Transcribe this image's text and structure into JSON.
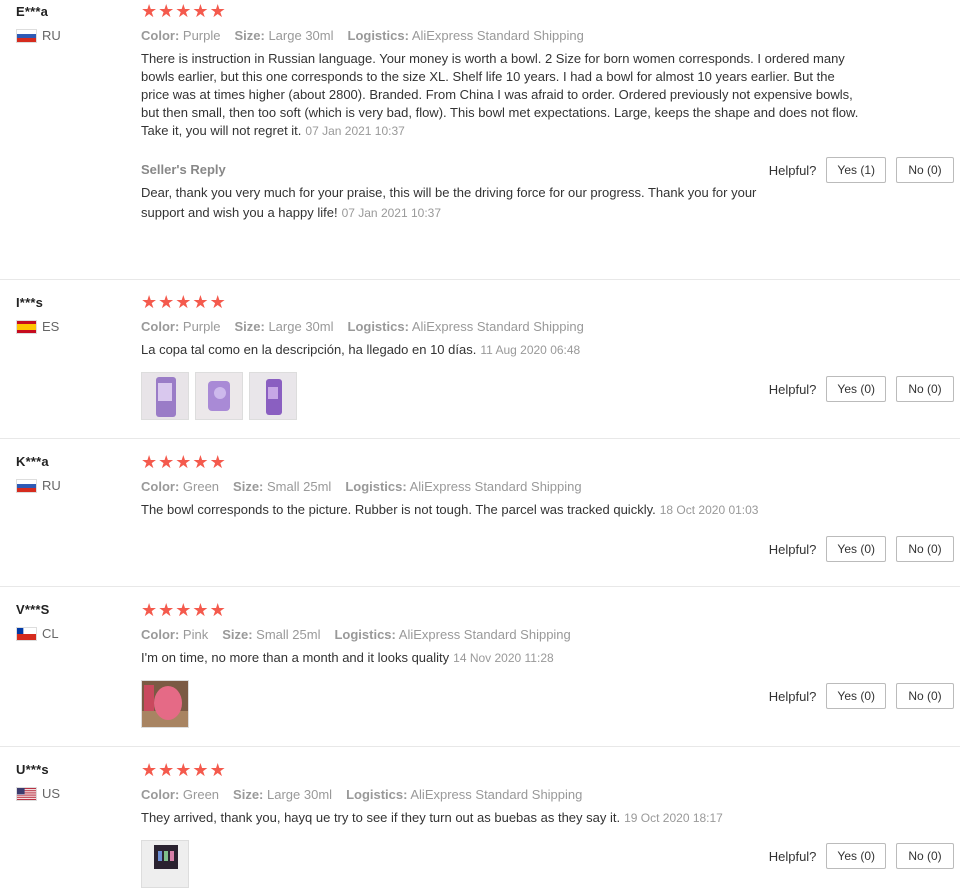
{
  "helpful_label": "Helpful?",
  "labels": {
    "color": "Color:",
    "size": "Size:",
    "logistics": "Logistics:"
  },
  "reviews": [
    {
      "user": "E***a",
      "country": "RU",
      "rating": 5,
      "color": "Purple",
      "size": "Large 30ml",
      "logistics": "AliExpress Standard Shipping",
      "text": "There is instruction in Russian language. Your money is worth a bowl. 2 Size for born women corresponds. I ordered many bowls earlier, but this one corresponds to the size XL. Shelf life 10 years. I had a bowl for almost 10 years earlier. But the price was at times higher (about 2800). Branded. From China I was afraid to order. Ordered previously not expensive bowls, but then small, then too soft (which is very bad, flow). This bowl met expectations. Large, keeps the shape and does not flow. Take it, you will not regret it.",
      "date": "07 Jan 2021 10:37",
      "yes": "Yes (1)",
      "no": "No (0)",
      "reply_title": "Seller's Reply",
      "reply_text": "Dear, thank you very much for your praise, this will be the driving force for our progress. Thank you for your support and wish you a happy life!",
      "reply_date": "07 Jan 2021 10:37"
    },
    {
      "user": "I***s",
      "country": "ES",
      "rating": 5,
      "color": "Purple",
      "size": "Large 30ml",
      "logistics": "AliExpress Standard Shipping",
      "text": "La copa tal como en la descripción, ha llegado en 10 días.",
      "date": "11 Aug 2020 06:48",
      "yes": "Yes (0)",
      "no": "No (0)",
      "photos": 3
    },
    {
      "user": "K***a",
      "country": "RU",
      "rating": 5,
      "color": "Green",
      "size": "Small 25ml",
      "logistics": "AliExpress Standard Shipping",
      "text": "The bowl corresponds to the picture. Rubber is not tough. The parcel was tracked quickly.",
      "date": "18 Oct 2020 01:03",
      "yes": "Yes (0)",
      "no": "No (0)"
    },
    {
      "user": "V***S",
      "country": "CL",
      "rating": 5,
      "color": "Pink",
      "size": "Small 25ml",
      "logistics": "AliExpress Standard Shipping",
      "text": "I'm on time, no more than a month and it looks quality",
      "date": "14 Nov 2020 11:28",
      "yes": "Yes (0)",
      "no": "No (0)",
      "photos": 1
    },
    {
      "user": "U***s",
      "country": "US",
      "rating": 5,
      "color": "Green",
      "size": "Large 30ml",
      "logistics": "AliExpress Standard Shipping",
      "text": "They arrived, thank you, hayq ue try to see if they turn out as buebas as they say it.",
      "date": "19 Oct 2020 18:17",
      "yes": "Yes (0)",
      "no": "No (0)",
      "photos": 1
    }
  ]
}
